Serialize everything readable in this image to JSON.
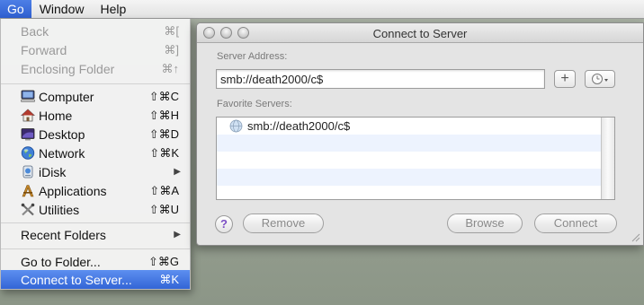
{
  "menubar": {
    "items": [
      {
        "label": "Go",
        "active": true
      },
      {
        "label": "Window"
      },
      {
        "label": "Help"
      }
    ]
  },
  "go_menu": {
    "items": [
      {
        "label": "Back",
        "shortcut": "⌘[",
        "enabled": false
      },
      {
        "label": "Forward",
        "shortcut": "⌘]",
        "enabled": false
      },
      {
        "label": "Enclosing Folder",
        "shortcut": "⌘↑",
        "enabled": false
      },
      {
        "label": "Computer",
        "shortcut": "⇧⌘C",
        "icon": "computer-icon"
      },
      {
        "label": "Home",
        "shortcut": "⇧⌘H",
        "icon": "home-icon"
      },
      {
        "label": "Desktop",
        "shortcut": "⇧⌘D",
        "icon": "desktop-icon"
      },
      {
        "label": "Network",
        "shortcut": "⇧⌘K",
        "icon": "network-globe-icon"
      },
      {
        "label": "iDisk",
        "submenu": true,
        "icon": "idisk-icon"
      },
      {
        "label": "Applications",
        "shortcut": "⇧⌘A",
        "icon": "applications-icon"
      },
      {
        "label": "Utilities",
        "shortcut": "⇧⌘U",
        "icon": "utilities-icon"
      },
      {
        "label": "Recent Folders",
        "submenu": true
      },
      {
        "label": "Go to Folder...",
        "shortcut": "⇧⌘G"
      },
      {
        "label": "Connect to Server...",
        "shortcut": "⌘K",
        "selected": true
      }
    ]
  },
  "dialog": {
    "title": "Connect to Server",
    "server_address_label": "Server Address:",
    "server_address_value": "smb://death2000/c$",
    "add_button": "+",
    "favorite_servers_label": "Favorite Servers:",
    "favorites": [
      "smb://death2000/c$"
    ],
    "help_button": "?",
    "remove_button": "Remove",
    "browse_button": "Browse",
    "connect_button": "Connect"
  },
  "colors": {
    "selection": "#3d6fe0",
    "desktop": "#9aa395",
    "list_alt_row": "#edf3fe"
  }
}
